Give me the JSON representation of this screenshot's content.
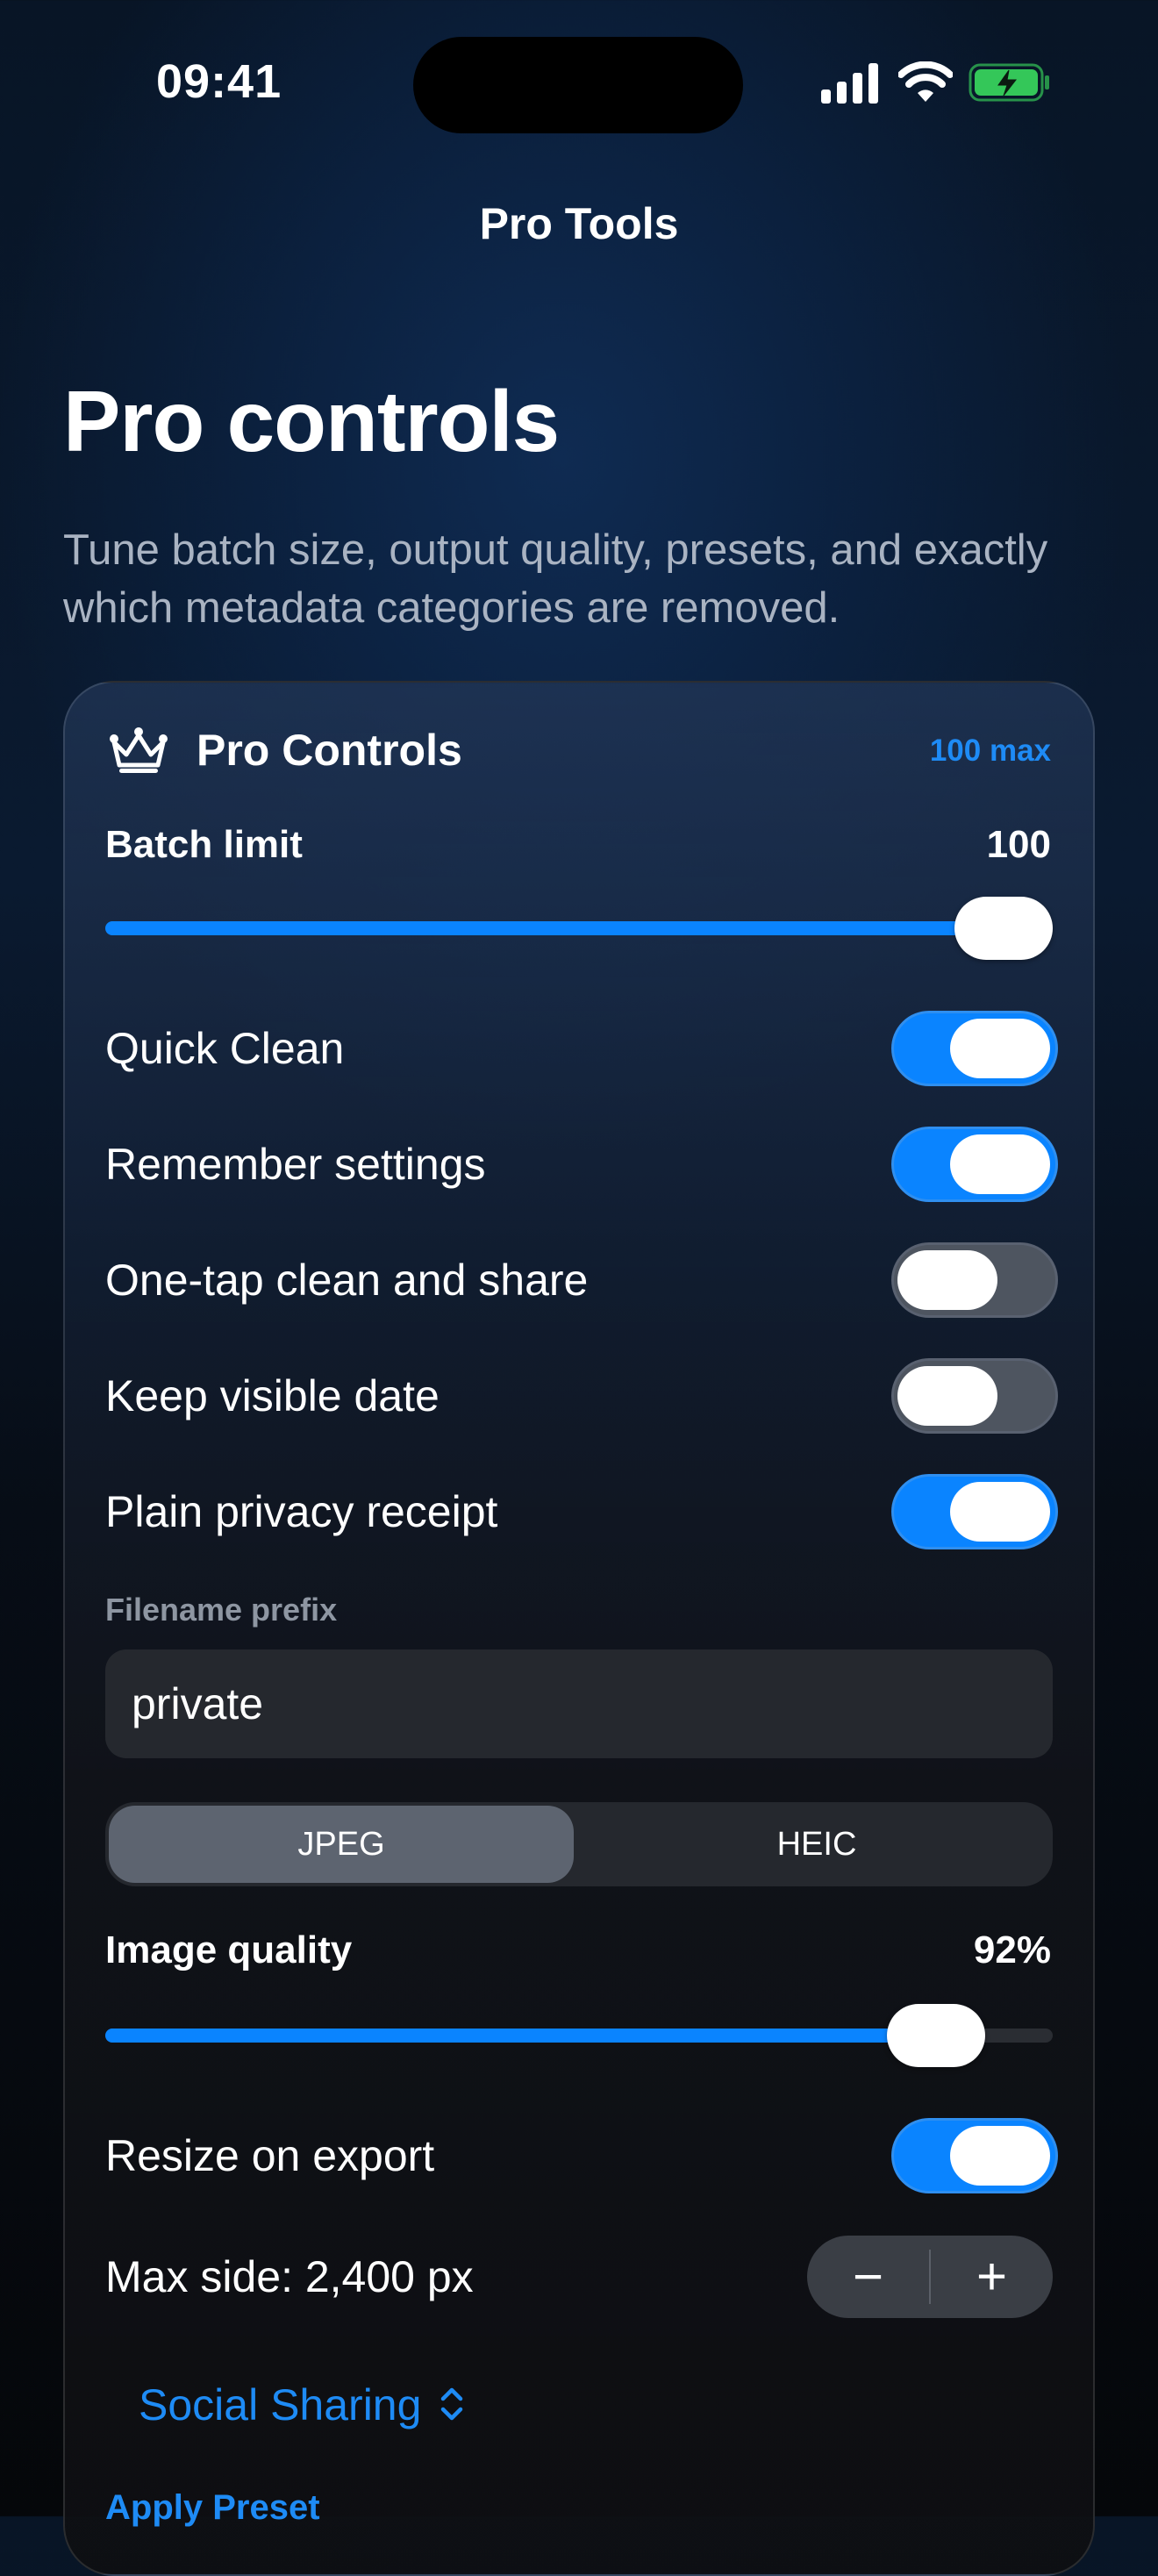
{
  "status_bar": {
    "time": "09:41"
  },
  "nav": {
    "title": "Pro Tools"
  },
  "header": {
    "title": "Pro controls",
    "subtitle": "Tune batch size, output quality, presets, and exactly which metadata categories are removed."
  },
  "card": {
    "title": "Pro Controls",
    "badge": "100 max",
    "batch_limit": {
      "label": "Batch limit",
      "value": "100",
      "level": 1.0
    },
    "toggles": [
      {
        "label": "Quick Clean",
        "on": true
      },
      {
        "label": "Remember settings",
        "on": true
      },
      {
        "label": "One-tap clean and share",
        "on": false
      },
      {
        "label": "Keep visible date",
        "on": false
      },
      {
        "label": "Plain privacy receipt",
        "on": true
      }
    ],
    "filename_prefix": {
      "label": "Filename prefix",
      "value": "private"
    },
    "format": {
      "options": [
        "JPEG",
        "HEIC"
      ],
      "selected": "JPEG"
    },
    "image_quality": {
      "label": "Image quality",
      "value": "92%",
      "level": 0.92
    },
    "resize": {
      "label": "Resize on export",
      "on": true
    },
    "max_side": {
      "label": "Max side: 2,400 px",
      "minus": "−",
      "plus": "+"
    },
    "preset": {
      "selected": "Social Sharing",
      "apply_label": "Apply Preset"
    }
  },
  "colors": {
    "accent": "#0a84ff",
    "link": "#1e8bf5",
    "toggle_off": "#4e5560"
  }
}
